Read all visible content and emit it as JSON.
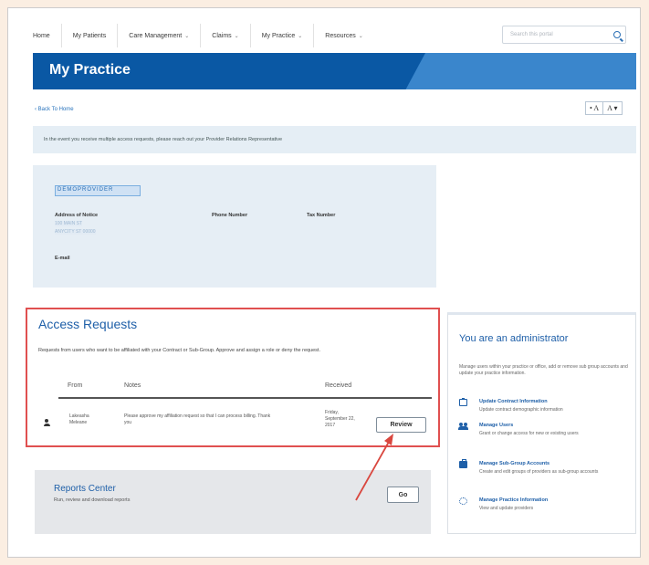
{
  "nav": {
    "items": [
      {
        "label": "Home",
        "has_menu": false
      },
      {
        "label": "My Patients",
        "has_menu": false
      },
      {
        "label": "Care Management",
        "has_menu": true
      },
      {
        "label": "Claims",
        "has_menu": true
      },
      {
        "label": "My Practice",
        "has_menu": true
      },
      {
        "label": "Resources",
        "has_menu": true
      }
    ],
    "search_placeholder": "Search this portal",
    "chevron": "⌄"
  },
  "banner": {
    "title": "My Practice"
  },
  "back_link": "‹ Back To Home",
  "font_controls": {
    "decrease": "• A",
    "increase": "A ▾"
  },
  "info_bar": "In the event you receive multiple access requests, please reach out your Provider Relations Representative",
  "provider": {
    "name": "DEMOPROVIDER",
    "address_label": "Address of Notice",
    "address_line1": "100 MAIN ST",
    "address_line2": "ANYCITY ST 00000",
    "phone_label": "Phone Number",
    "tax_label": "Tax Number",
    "email_label": "E-mail"
  },
  "access_requests": {
    "title": "Access Requests",
    "description": "Requests from users who want to be affiliated with your Contract or Sub-Group. Approve and assign a role or deny the request.",
    "col_from": "From",
    "col_notes": "Notes",
    "col_received": "Received",
    "row": {
      "from_first": "Lakeasha",
      "from_last": "Meleane",
      "notes_1": "Please approve my affiliation request so that I can process billing. Thank",
      "notes_2": "you",
      "received_1": "Friday,",
      "received_2": "September 22,",
      "received_3": "2017",
      "review_label": "Review"
    }
  },
  "reports": {
    "title": "Reports Center",
    "description": "Run, review and download reports",
    "go_label": "Go"
  },
  "admin": {
    "title": "You are an administrator",
    "description": "Manage users within your practice or office, add or remove sub group accounts and update your practice information.",
    "items": [
      {
        "title": "Update Contract Information",
        "desc": "Update contract demographic information",
        "icon": "clipboard-icon"
      },
      {
        "title": "Manage Users",
        "desc": "Grant or change access for new or existing users",
        "icon": "users-icon"
      },
      {
        "title": "Manage Sub-Group Accounts",
        "desc": "Create and edit groups of providers as sub-group accounts",
        "icon": "briefcase-icon"
      },
      {
        "title": "Manage Practice Information",
        "desc": "View and update providers",
        "icon": "gear-icon"
      }
    ]
  },
  "colors": {
    "banner_dark": "#0a58a4",
    "banner_light": "#3a86cc",
    "highlight_red": "#e05050",
    "link_blue": "#1e5fa8"
  }
}
